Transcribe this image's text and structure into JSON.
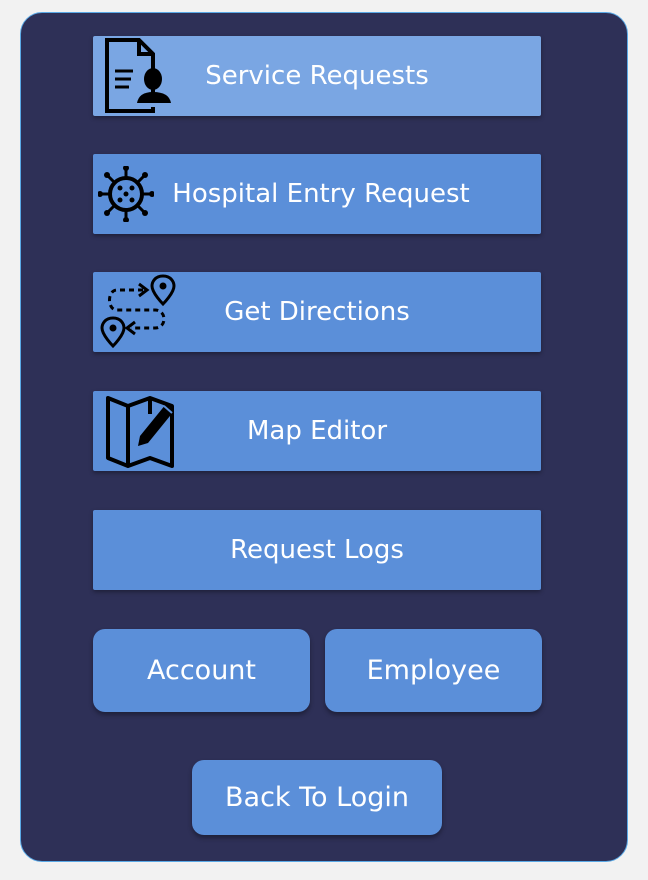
{
  "menu": {
    "service_requests": "Service Requests",
    "hospital_entry_request": "Hospital Entry Request",
    "get_directions": "Get Directions",
    "map_editor": "Map Editor",
    "request_logs": "Request Logs"
  },
  "bottom": {
    "account": "Account",
    "employee": "Employee",
    "back_to_login": "Back To Login"
  },
  "icons": {
    "service_requests": "document-person-icon",
    "hospital_entry_request": "virus-icon",
    "get_directions": "route-icon",
    "map_editor": "map-edit-icon"
  },
  "colors": {
    "panel": "#2e3057",
    "panel_border": "#5aa9e6",
    "button": "#5b8fd9",
    "button_active": "#7aa6e3",
    "text": "#ffffff"
  }
}
